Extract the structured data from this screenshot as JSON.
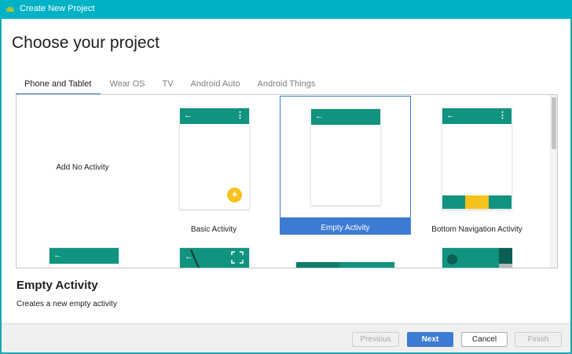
{
  "window": {
    "title": "Create New Project",
    "icon": "android-studio-icon"
  },
  "page": {
    "heading": "Choose your project"
  },
  "tabs": [
    {
      "label": "Phone and Tablet",
      "active": true
    },
    {
      "label": "Wear OS",
      "active": false
    },
    {
      "label": "TV",
      "active": false
    },
    {
      "label": "Android Auto",
      "active": false
    },
    {
      "label": "Android Things",
      "active": false
    }
  ],
  "templates": [
    {
      "label": "Add No Activity",
      "selected": false
    },
    {
      "label": "Basic Activity",
      "selected": false
    },
    {
      "label": "Empty Activity",
      "selected": true
    },
    {
      "label": "Bottom Navigation Activity",
      "selected": false
    }
  ],
  "detail": {
    "title": "Empty Activity",
    "description": "Creates a new empty activity"
  },
  "buttons": {
    "previous": "Previous",
    "next": "Next",
    "cancel": "Cancel",
    "finish": "Finish"
  },
  "glyphs": {
    "back": "←",
    "menu": "⋮",
    "plus": "+"
  },
  "colors": {
    "titlebar": "#00b2c5",
    "appbar": "#10937f",
    "accent": "#3d7bd5",
    "fab": "#f6c21c"
  }
}
